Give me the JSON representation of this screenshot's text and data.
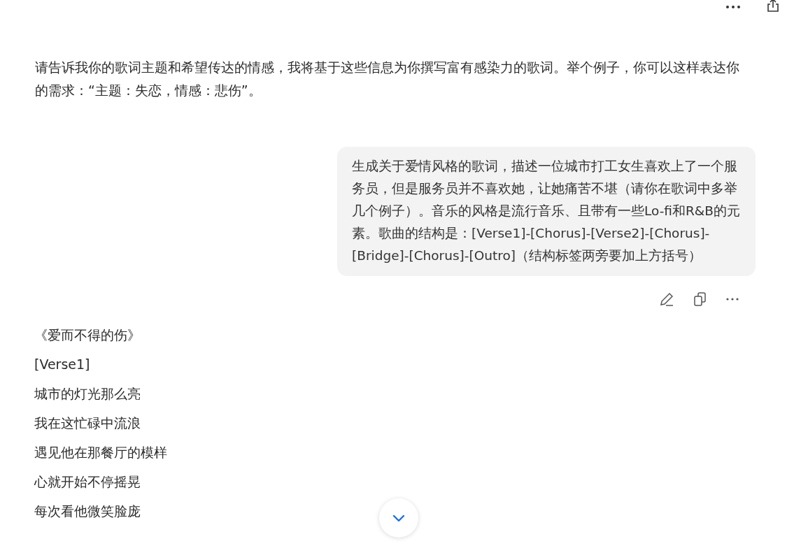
{
  "assistant_intro": "请告诉我你的歌词主题和希望传达的情感，我将基于这些信息为你撰写富有感染力的歌词。举个例子，你可以这样表达你的需求：“主题：失恋，情感：悲伤”。",
  "user_message": "生成关于爱情风格的歌词，描述一位城市打工女生喜欢上了一个服务员，但是服务员并不喜欢她，让她痛苦不堪（请你在歌词中多举几个例子）。音乐的风格是流行音乐、且带有一些Lo-fi和R&B的元素。歌曲的结构是：[Verse1]-[Chorus]-[Verse2]-[Chorus]-[Bridge]-[Chorus]-[Outro]（结构标签两旁要加上方括号）",
  "reply_lines": [
    "《爱而不得的伤》",
    "[Verse1]",
    "城市的灯光那么亮",
    "我在这忙碌中流浪",
    "遇见他在那餐厅的模样",
    "心就开始不停摇晃",
    "每次看他微笑脸庞"
  ]
}
